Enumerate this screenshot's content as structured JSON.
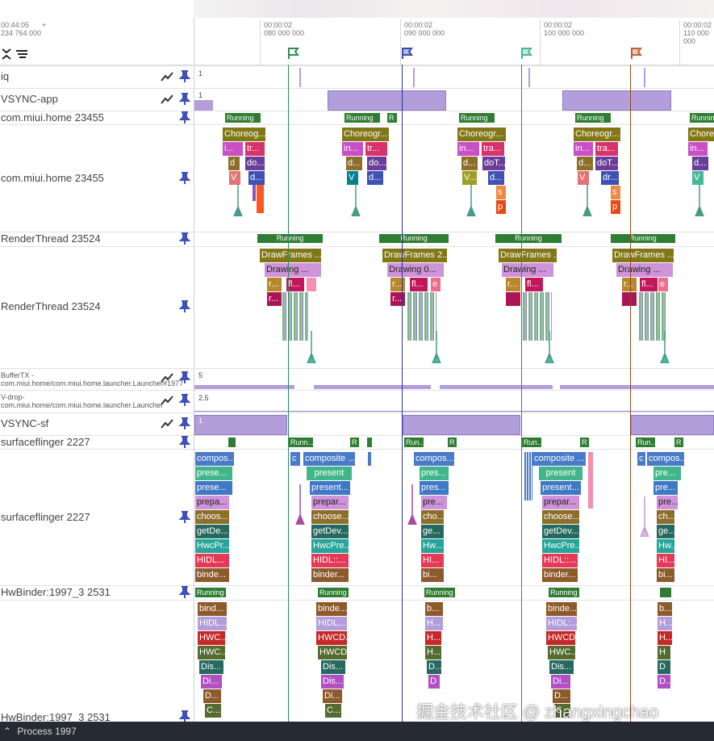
{
  "colors": {
    "running": "#2e7d32",
    "vsync": "#b39ddb",
    "green_flag": "#2e8b57",
    "purple_flag": "#6a5acd",
    "teal_flag": "#48b89a",
    "brown_flag": "#b5643c",
    "footer_bg": "#262b33"
  },
  "ruler": {
    "left_time": "00:44:05",
    "left_ns": "234 764 000",
    "plus": "+",
    "ticks": [
      {
        "t": "00:00:02",
        "ns": "080 000 000"
      },
      {
        "t": "00:00:02",
        "ns": "090 000 000"
      },
      {
        "t": "00:00:02",
        "ns": "100 000 000"
      },
      {
        "t": "00:00:02",
        "ns": "110 000 000"
      }
    ]
  },
  "icons": {
    "collapse": "collapse-all-icon",
    "filter": "filter-lines-icon",
    "chart": "counter-chart-icon",
    "pin": "pin-icon",
    "flag": "flag-icon"
  },
  "tracks": {
    "iq": {
      "name": "iq",
      "value": "1"
    },
    "vsync_app": {
      "name": "VSYNC-app",
      "value": "1"
    },
    "home_summary": {
      "name": "com.miui.home 23455"
    },
    "home": {
      "name": "com.miui.home 23455"
    },
    "rt_summary": {
      "name": "RenderThread 23524"
    },
    "rt": {
      "name": "RenderThread 23524"
    },
    "buffertx": {
      "name": "BufferTX - com.miui.home/com.miui.home.launcher.Launcher#1977",
      "value": "5"
    },
    "vdrop": {
      "name": "V-drop-com.miui.home/com.miui.home.launcher.Launcher",
      "value": "2.5"
    },
    "vsync_sf": {
      "name": "VSYNC-sf",
      "value": "1"
    },
    "sf_summary": {
      "name": "surfaceflinger 2227"
    },
    "sf": {
      "name": "surfaceflinger 2227"
    },
    "hwb_summary": {
      "name": "HwBinder:1997_3 2531"
    },
    "hwb2": {
      "name": "HwBinder:1997_3 2531"
    }
  },
  "slices": {
    "home_running": [
      "Running",
      "Running",
      "R",
      "Running",
      "Running",
      "Running"
    ],
    "home_d1": [
      "Choreog...",
      "Choreogr...",
      "Choreogr...",
      "Choreogr...",
      "Chore"
    ],
    "home_d2": [
      "i...",
      "tr...",
      "in...",
      "tr...",
      "in...",
      "tra...",
      "in...",
      "tra...",
      "in..."
    ],
    "home_d3": [
      "d",
      "do...",
      "d...",
      "do...",
      "d...",
      "doT...",
      "d...",
      "doT...",
      "d..."
    ],
    "home_d4": [
      "V",
      "d...",
      "V",
      "d...",
      "V...",
      "d...",
      "V",
      "dr...",
      "V"
    ],
    "home_d5": [
      "s",
      "s"
    ],
    "home_d6": [
      "p",
      "p"
    ],
    "rt_running": [
      "Running",
      "Running",
      "Running",
      "Running"
    ],
    "rt_d1": [
      "DrawFrames ...",
      "DrawFrames 2...",
      "DrawFrames ...",
      "DrawFrames ..."
    ],
    "rt_d2": [
      "Drawing ...",
      "Drawing  0...",
      "Drawing ...",
      "Drawing ..."
    ],
    "rt_d3": [
      "r...",
      "fl...",
      "r...",
      "fl...",
      "e",
      "r...",
      "fl...",
      "r...",
      "fl...",
      "e"
    ],
    "rt_d4": [
      "r...",
      "r..."
    ],
    "sf_running": [
      "Runn...",
      "R",
      "Run...",
      "R",
      "Run...",
      "R",
      "Run...",
      "R"
    ],
    "sf_d1": [
      "compos...",
      "c",
      "composite ...",
      "compos...",
      "composite ...",
      "c",
      "compos..."
    ],
    "sf_d2": [
      "prese...",
      "present",
      "pres...",
      "present",
      "pre..."
    ],
    "sf_d3": [
      "prese...",
      "present...",
      "pres...",
      "present...",
      "pre..."
    ],
    "sf_d4": [
      "prepa...",
      "prepar...",
      "pre...",
      "prepar...",
      "pre..."
    ],
    "sf_d5": [
      "choos...",
      "choose...",
      "cho...",
      "choose...",
      "ch..."
    ],
    "sf_d6": [
      "getDe...",
      "getDev...",
      "ge...",
      "getDev...",
      "ge..."
    ],
    "sf_d7": [
      "HwcPr...",
      "HwcPre...",
      "Hw...",
      "HwcPre...",
      "Hw..."
    ],
    "sf_d8": [
      "HIDL...",
      "HIDL::...",
      "HI...",
      "HIDL::...",
      "HI..."
    ],
    "sf_d9": [
      "binde...",
      "binder...",
      "bi...",
      "binder...",
      "bi..."
    ],
    "hwb_running": [
      "Running",
      "Running",
      "Running",
      "Running"
    ],
    "hwb_d1": [
      "bind...",
      "binde...",
      "b...",
      "binde...",
      "b..."
    ],
    "hwb_d2": [
      "HIDL...",
      "HIDL...",
      "H...",
      "HIDL:...",
      "H..."
    ],
    "hwb_d3": [
      "HWC...",
      "HWCD...",
      "H...",
      "HWCD...",
      "H..."
    ],
    "hwb_d4": [
      "HWC...",
      "HWCD...",
      "H...",
      "HWC...",
      "H"
    ],
    "hwb_d5": [
      "Dis...",
      "Dis...",
      "D...",
      "Dis...",
      "D"
    ],
    "hwb_d6": [
      "Di...",
      "Dis...",
      "D",
      "Di...",
      "D..."
    ],
    "hwb_d7": [
      "D...",
      "Di...",
      "D..."
    ],
    "hwb_d8": [
      "C...",
      "C...",
      "C..."
    ]
  },
  "footer": {
    "label": "Process 1997"
  },
  "watermark": "掘金技术社区 @ zhangxingchao"
}
